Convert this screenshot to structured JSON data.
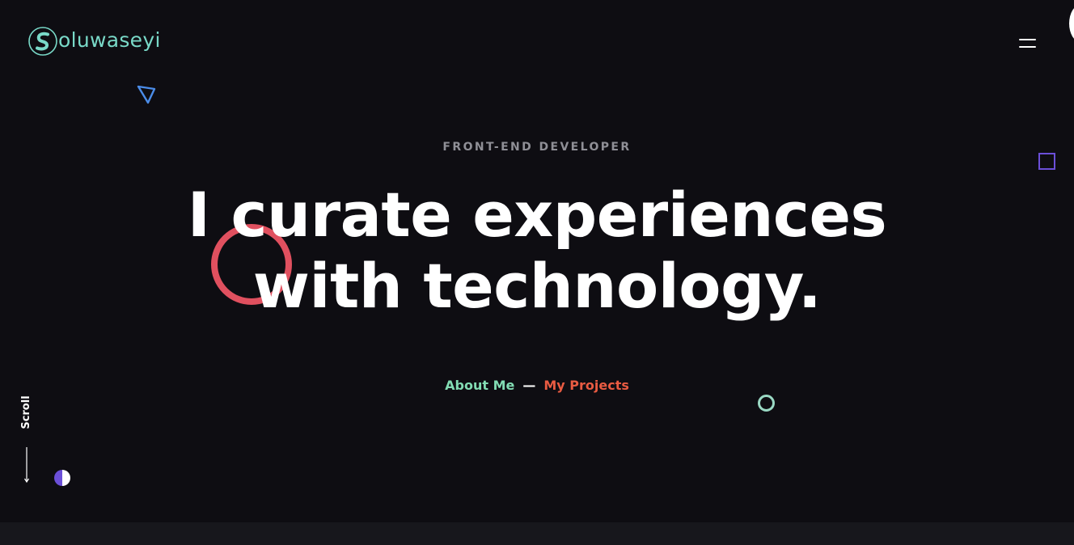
{
  "brand": {
    "logo_text": "oluwaseyi",
    "logo_letter": "S",
    "accent": "#79d9c8"
  },
  "header": {
    "menu_icon": "hamburger-menu-icon"
  },
  "hero": {
    "eyebrow": "FRONT-END DEVELOPER",
    "headline_line1": "I curate experiences",
    "headline_line2": "with technology.",
    "links": {
      "about": "About Me",
      "separator": "—",
      "projects": "My Projects"
    },
    "link_colors": {
      "about": "#82dcb3",
      "projects": "#e95b42"
    }
  },
  "scroll": {
    "label": "Scroll",
    "icon": "arrow-down-icon"
  },
  "decorations": {
    "triangle_color": "#4b8ce8",
    "square_color": "#6b4fd8",
    "ring_large_color": "#e0505f",
    "ring_small_color": "#9ad9c4",
    "half_circle_colors": [
      "#6b4fd8",
      "#ffffff"
    ]
  }
}
